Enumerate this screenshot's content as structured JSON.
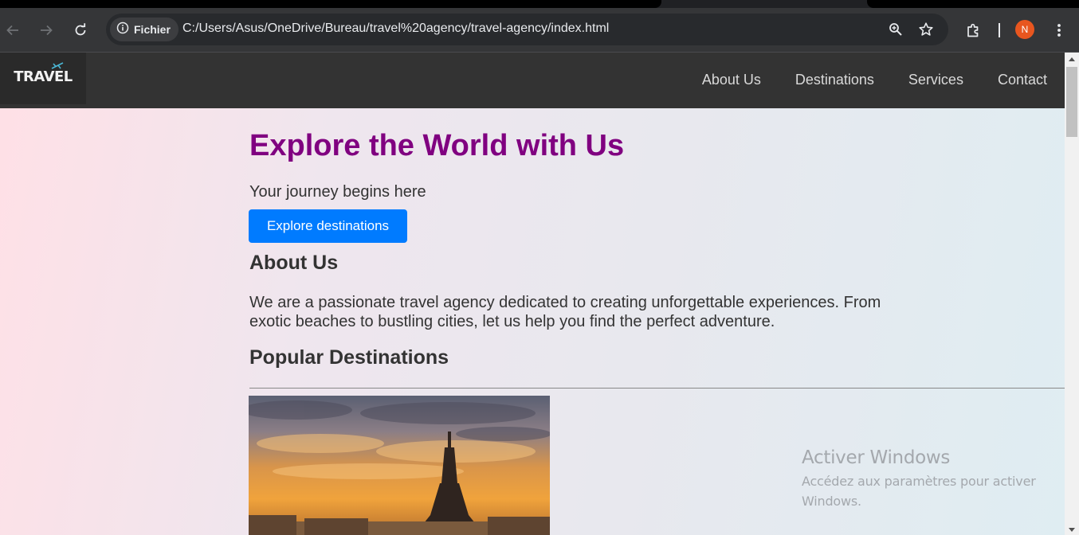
{
  "browser": {
    "security_chip": "Fichier",
    "url": "C:/Users/Asus/OneDrive/Bureau/travel%20agency/travel-agency/index.html",
    "profile_initial": "N",
    "profile_color": "#e8561f",
    "icons": [
      "back-icon",
      "forward-icon",
      "reload-icon",
      "info-icon",
      "zoom-icon",
      "star-icon",
      "extensions-icon",
      "more-icon"
    ]
  },
  "site": {
    "logo_text": "TRAVEL",
    "nav": [
      {
        "label": "About Us"
      },
      {
        "label": "Destinations"
      },
      {
        "label": "Services"
      },
      {
        "label": "Contact"
      }
    ],
    "hero": {
      "title": "Explore the World with Us",
      "subtitle": "Your journey begins here",
      "cta": "Explore destinations"
    },
    "about": {
      "title": "About Us",
      "text": "We are a passionate travel agency dedicated to creating unforgettable experiences. From exotic beaches to bustling cities, let us help you find the perfect adventure."
    },
    "destinations": {
      "title": "Popular Destinations",
      "image_subject": "eiffel-tower-sunset"
    },
    "colors": {
      "title": "#800080",
      "button": "#007bff",
      "navbar": "#333333"
    }
  },
  "os": {
    "watermark_title": "Activer Windows",
    "watermark_text": "Accédez aux paramètres pour activer Windows."
  }
}
